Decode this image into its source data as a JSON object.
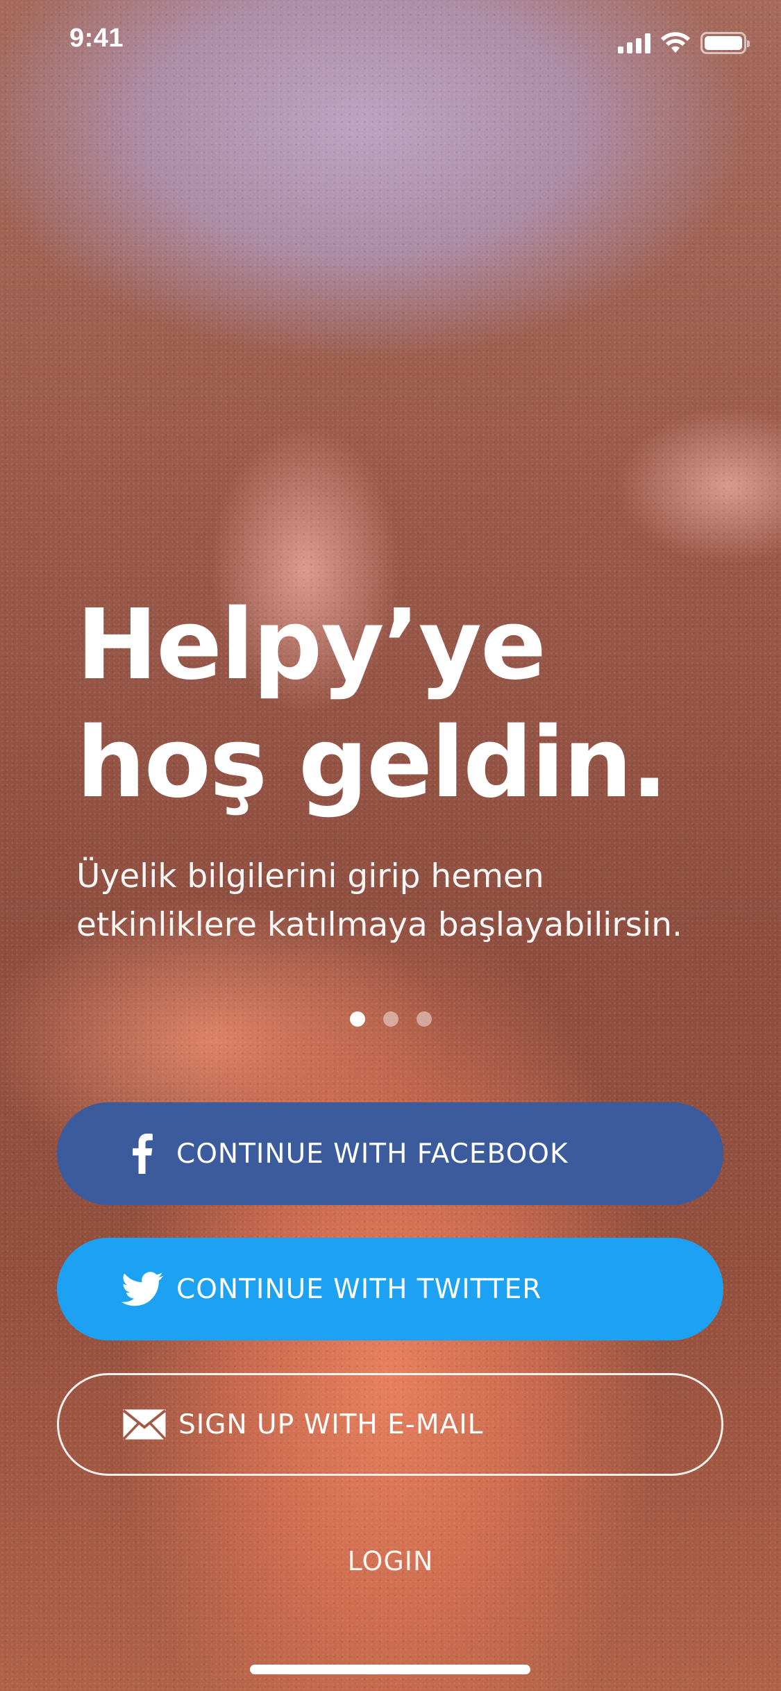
{
  "status_bar": {
    "time": "9:41",
    "icons": [
      "cellular-signal-icon",
      "wifi-icon",
      "battery-icon"
    ]
  },
  "welcome": {
    "title_line1": "Helpy’ye",
    "title_line2": "hoş geldin.",
    "subtitle_line1": "Üyelik bilgilerini girip hemen",
    "subtitle_line2": "etkinliklere katılmaya başlayabilirsin."
  },
  "pager": {
    "count": 3,
    "active_index": 0
  },
  "buttons": {
    "facebook": {
      "label": "CONTINUE WITH FACEBOOK",
      "icon": "facebook-icon",
      "color": "#3b5b9d"
    },
    "twitter": {
      "label": "CONTINUE WITH TWITTER",
      "icon": "twitter-icon",
      "color": "#1da1f2"
    },
    "email": {
      "label": "SIGN UP WITH E-MAIL",
      "icon": "mail-icon"
    }
  },
  "login": {
    "label": "LOGIN"
  }
}
